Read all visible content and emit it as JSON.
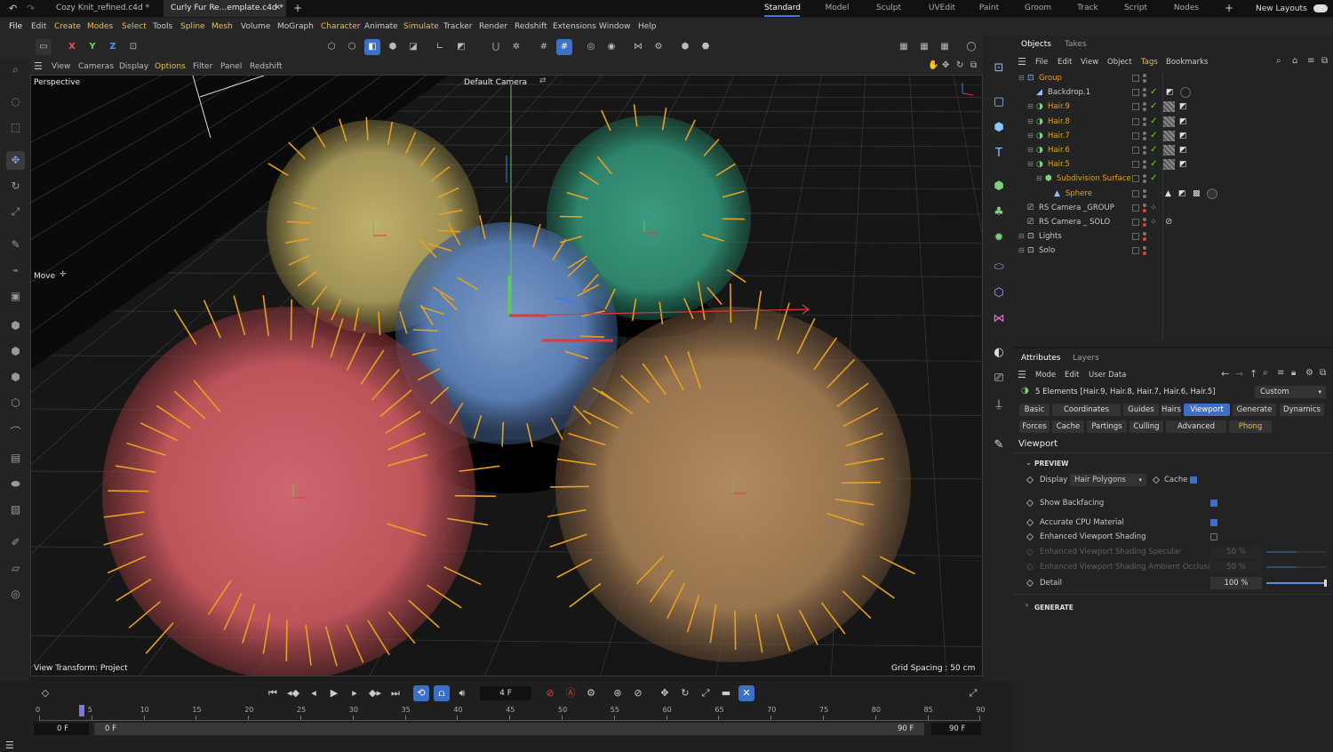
{
  "tabs": {
    "doc1": "Cozy Knit_refined.c4d *",
    "doc2": "Curly Fur Re...emplate.c4d *",
    "layouts": [
      "Standard",
      "Model",
      "Sculpt",
      "UVEdit",
      "Paint",
      "Groom",
      "Track",
      "Script",
      "Nodes"
    ],
    "new_layouts": "New Layouts"
  },
  "menu": [
    "File",
    "Edit",
    "Create",
    "Modes",
    "Select",
    "Tools",
    "Spline",
    "Mesh",
    "Volume",
    "MoGraph",
    "Character",
    "Animate",
    "Simulate",
    "Tracker",
    "Render",
    "Redshift",
    "Extensions",
    "Window",
    "Help"
  ],
  "toolbar": {
    "x": "X",
    "y": "Y",
    "z": "Z"
  },
  "viewport": {
    "menu": [
      "View",
      "Cameras",
      "Display",
      "Options",
      "Filter",
      "Panel",
      "Redshift"
    ],
    "name": "Perspective",
    "camera": "Default Camera",
    "tool": "Move",
    "transform": "View Transform: Project",
    "grid": "Grid Spacing : 50 cm",
    "colors": {
      "yellow": "#b0a05a",
      "green": "#2f8f74",
      "blue": "#5a7fb5",
      "red": "#c2565c",
      "brown": "#a07a52",
      "guides": "#e8a020"
    }
  },
  "timeline": {
    "current_frame": "4 F",
    "ticks": [
      "0",
      "5",
      "10",
      "15",
      "20",
      "25",
      "30",
      "35",
      "40",
      "45",
      "50",
      "55",
      "60",
      "65",
      "70",
      "75",
      "80",
      "85",
      "90"
    ],
    "start": "0 F",
    "range_start": "0 F",
    "range_end": "90 F",
    "end": "90 F"
  },
  "objects_panel": {
    "tabs": [
      "Objects",
      "Takes"
    ],
    "menu": [
      "File",
      "Edit",
      "View",
      "Object",
      "Tags",
      "Bookmarks"
    ],
    "items": [
      {
        "name": "Group",
        "color": "#e8a020"
      },
      {
        "name": "Backdrop.1",
        "color": "#c8c8c8"
      },
      {
        "name": "Hair.9",
        "color": "#e8a020"
      },
      {
        "name": "Hair.8",
        "color": "#e8a020"
      },
      {
        "name": "Hair.7",
        "color": "#e8a020"
      },
      {
        "name": "Hair.6",
        "color": "#e8a020"
      },
      {
        "name": "Hair.5",
        "color": "#e8a020"
      },
      {
        "name": "Subdivision Surface",
        "color": "#e8a020"
      },
      {
        "name": "Sphere",
        "color": "#e8a020"
      },
      {
        "name": "RS Camera _GROUP",
        "color": "#c8c8c8"
      },
      {
        "name": "RS Camera _ SOLO",
        "color": "#c8c8c8"
      },
      {
        "name": "Lights",
        "color": "#c8c8c8"
      },
      {
        "name": "Solo",
        "color": "#c8c8c8"
      }
    ]
  },
  "attributes": {
    "tabs": [
      "Attributes",
      "Layers"
    ],
    "menu": [
      "Mode",
      "Edit",
      "User Data"
    ],
    "selection": "5 Elements [Hair.9, Hair.8, Hair.7, Hair.6, Hair.5]",
    "preset": "Custom",
    "subtabs1": [
      "Basic",
      "Coordinates",
      "Guides",
      "Hairs",
      "Viewport",
      "Generate",
      "Dynamics"
    ],
    "subtabs2": [
      "Forces",
      "Cache",
      "Partings",
      "Culling",
      "Advanced",
      "Phong"
    ],
    "section": "Viewport",
    "group1": "PREVIEW",
    "display_label": "Display",
    "display_value": "Hair Polygons",
    "cache_label": "Cache",
    "show_backfacing": "Show Backfacing",
    "accurate_cpu": "Accurate CPU Material",
    "enhanced": "Enhanced Viewport Shading",
    "enhanced_spec": "Enhanced Viewport Shading Specular",
    "enhanced_spec_val": "50 %",
    "enhanced_ao": "Enhanced Viewport Shading Ambient Occlusion",
    "enhanced_ao_val": "50 %",
    "detail": "Detail",
    "detail_val": "100 %",
    "group2": "GENERATE"
  }
}
